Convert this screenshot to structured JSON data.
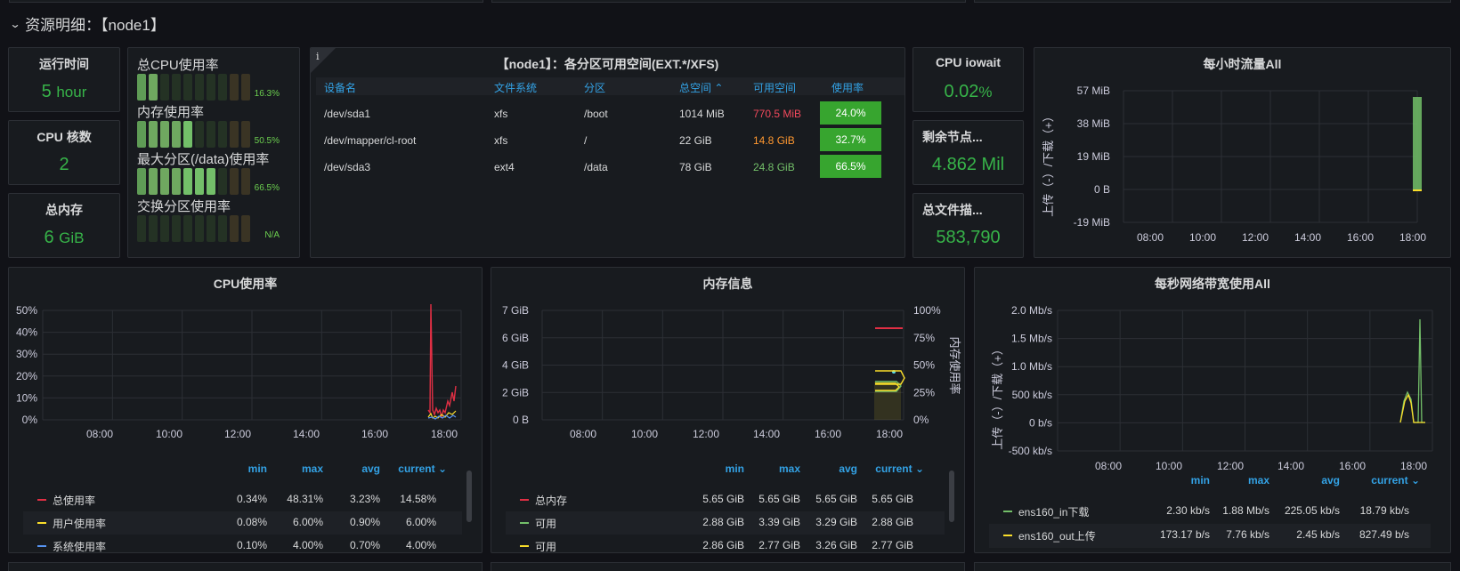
{
  "row": {
    "title": "资源明细：【node1】"
  },
  "stats": {
    "uptime": {
      "title": "运行时间",
      "value": "5",
      "unit": "hour"
    },
    "cpu_cores": {
      "title": "CPU 核数",
      "value": "2"
    },
    "mem_total": {
      "title": "总内存",
      "value": "6",
      "unit": "GiB"
    },
    "iowait": {
      "title": "CPU iowait",
      "value": "0.02",
      "unit": "%"
    },
    "free_nodes": {
      "title": "剩余节点...",
      "value": "4.862 Mil"
    },
    "file_desc": {
      "title": "总文件描...",
      "value": "583,790"
    }
  },
  "gauges": [
    {
      "label": "总CPU使用率",
      "value_text": "16.3%",
      "value": 16.3
    },
    {
      "label": "内存使用率",
      "value_text": "50.5%",
      "value": 50.5
    },
    {
      "label": "最大分区(/data)使用率",
      "value_text": "66.5%",
      "value": 66.5
    },
    {
      "label": "交换分区使用率",
      "value_text": "N/A",
      "value": 0
    }
  ],
  "fs_table": {
    "title": "【node1】：各分区可用空间(EXT.*/XFS)",
    "info_icon": "i",
    "headers": [
      "设备名",
      "文件系统",
      "分区",
      "总空间",
      "可用空间",
      "使用率"
    ],
    "rows": [
      {
        "device": "/dev/sda1",
        "fs": "xfs",
        "mount": "/boot",
        "total": "1014 MiB",
        "avail": "770.5 MiB",
        "avail_color": "#f2495c",
        "usage": "24.0%"
      },
      {
        "device": "/dev/mapper/cl-root",
        "fs": "xfs",
        "mount": "/",
        "total": "22 GiB",
        "avail": "14.8 GiB",
        "avail_color": "#ff9830",
        "usage": "32.7%"
      },
      {
        "device": "/dev/sda3",
        "fs": "ext4",
        "mount": "/data",
        "total": "78 GiB",
        "avail": "24.8 GiB",
        "avail_color": "#73bf69",
        "usage": "66.5%"
      }
    ]
  },
  "charts": {
    "hourly": {
      "title": "每小时流量All",
      "ylabel": "上传（-）/下载（+）",
      "yticks": [
        "57 MiB",
        "38 MiB",
        "19 MiB",
        "0 B",
        "-19 MiB"
      ],
      "xticks": [
        "08:00",
        "10:00",
        "12:00",
        "14:00",
        "16:00",
        "18:00"
      ]
    },
    "cpu": {
      "title": "CPU使用率",
      "yticks": [
        "50%",
        "40%",
        "30%",
        "20%",
        "10%",
        "0%"
      ],
      "xticks": [
        "08:00",
        "10:00",
        "12:00",
        "14:00",
        "16:00",
        "18:00"
      ],
      "legend_headers": [
        "min",
        "max",
        "avg",
        "current"
      ],
      "series": [
        {
          "name": "总使用率",
          "color": "#e02f44",
          "min": "0.34%",
          "max": "48.31%",
          "avg": "3.23%",
          "current": "14.58%"
        },
        {
          "name": "用户使用率",
          "color": "#fade2a",
          "min": "0.08%",
          "max": "6.00%",
          "avg": "0.90%",
          "current": "6.00%"
        },
        {
          "name": "系统使用率",
          "color": "#5794f2",
          "min": "0.10%",
          "max": "4.00%",
          "avg": "0.70%",
          "current": "4.00%"
        }
      ]
    },
    "mem": {
      "title": "内存信息",
      "yticks": [
        "7 GiB",
        "6 GiB",
        "4 GiB",
        "2 GiB",
        "0 B"
      ],
      "yticks_right": [
        "100%",
        "75%",
        "50%",
        "25%",
        "0%"
      ],
      "ylabel_right": "内存使用率",
      "xticks": [
        "08:00",
        "10:00",
        "12:00",
        "14:00",
        "16:00",
        "18:00"
      ],
      "legend_headers": [
        "min",
        "max",
        "avg",
        "current"
      ],
      "series": [
        {
          "name": "总内存",
          "color": "#e02f44",
          "min": "5.65 GiB",
          "max": "5.65 GiB",
          "avg": "5.65 GiB",
          "current": "5.65 GiB"
        },
        {
          "name": "可用",
          "color": "#73bf69",
          "min": "2.88 GiB",
          "max": "3.39 GiB",
          "avg": "3.29 GiB",
          "current": "2.88 GiB"
        },
        {
          "name": "可用",
          "color": "#fade2a",
          "min": "2.86 GiB",
          "max": "2.77 GiB",
          "avg": "3.26 GiB",
          "current": "2.77 GiB"
        }
      ]
    },
    "net": {
      "title": "每秒网络带宽使用All",
      "ylabel": "上传（-）/下载（+）",
      "yticks": [
        "2.0 Mb/s",
        "1.5 Mb/s",
        "1.0 Mb/s",
        "500 kb/s",
        "0 b/s",
        "-500 kb/s"
      ],
      "xticks": [
        "08:00",
        "10:00",
        "12:00",
        "14:00",
        "16:00",
        "18:00"
      ],
      "legend_headers": [
        "min",
        "max",
        "avg",
        "current"
      ],
      "series": [
        {
          "name": "ens160_in下载",
          "color": "#73bf69",
          "min": "2.30 kb/s",
          "max": "1.88 Mb/s",
          "avg": "225.05 kb/s",
          "current": "18.79 kb/s"
        },
        {
          "name": "ens160_out上传",
          "color": "#fade2a",
          "min": "173.17 b/s",
          "max": "7.76 kb/s",
          "avg": "2.45 kb/s",
          "current": "827.49 b/s"
        }
      ]
    }
  }
}
